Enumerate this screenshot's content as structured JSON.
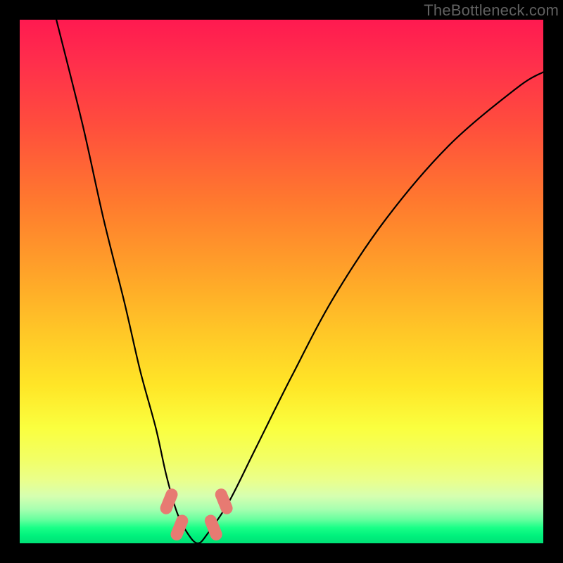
{
  "watermark": "TheBottleneck.com",
  "chart_data": {
    "type": "line",
    "title": "",
    "xlabel": "",
    "ylabel": "",
    "xlim": [
      0,
      100
    ],
    "ylim": [
      0,
      100
    ],
    "grid": false,
    "legend": false,
    "series": [
      {
        "name": "bottleneck-curve",
        "x": [
          7,
          12,
          16,
          20,
          23,
          26,
          28,
          30,
          32,
          34,
          36,
          40,
          45,
          52,
          60,
          70,
          82,
          95,
          100
        ],
        "values": [
          100,
          80,
          62,
          46,
          33,
          22,
          13,
          6,
          2,
          0,
          2,
          8,
          18,
          32,
          47,
          62,
          76,
          87,
          90
        ]
      }
    ],
    "markers": [
      {
        "name": "trough-marker-1",
        "x": 28.5,
        "y": 8
      },
      {
        "name": "trough-marker-2",
        "x": 30.5,
        "y": 3
      },
      {
        "name": "trough-marker-3",
        "x": 37.0,
        "y": 3
      },
      {
        "name": "trough-marker-4",
        "x": 39.0,
        "y": 8
      }
    ],
    "colors": {
      "curve": "#000000",
      "marker": "#e77a72",
      "gradient_top": "#ff1a50",
      "gradient_mid": "#ffe627",
      "gradient_bottom": "#00e076"
    }
  }
}
